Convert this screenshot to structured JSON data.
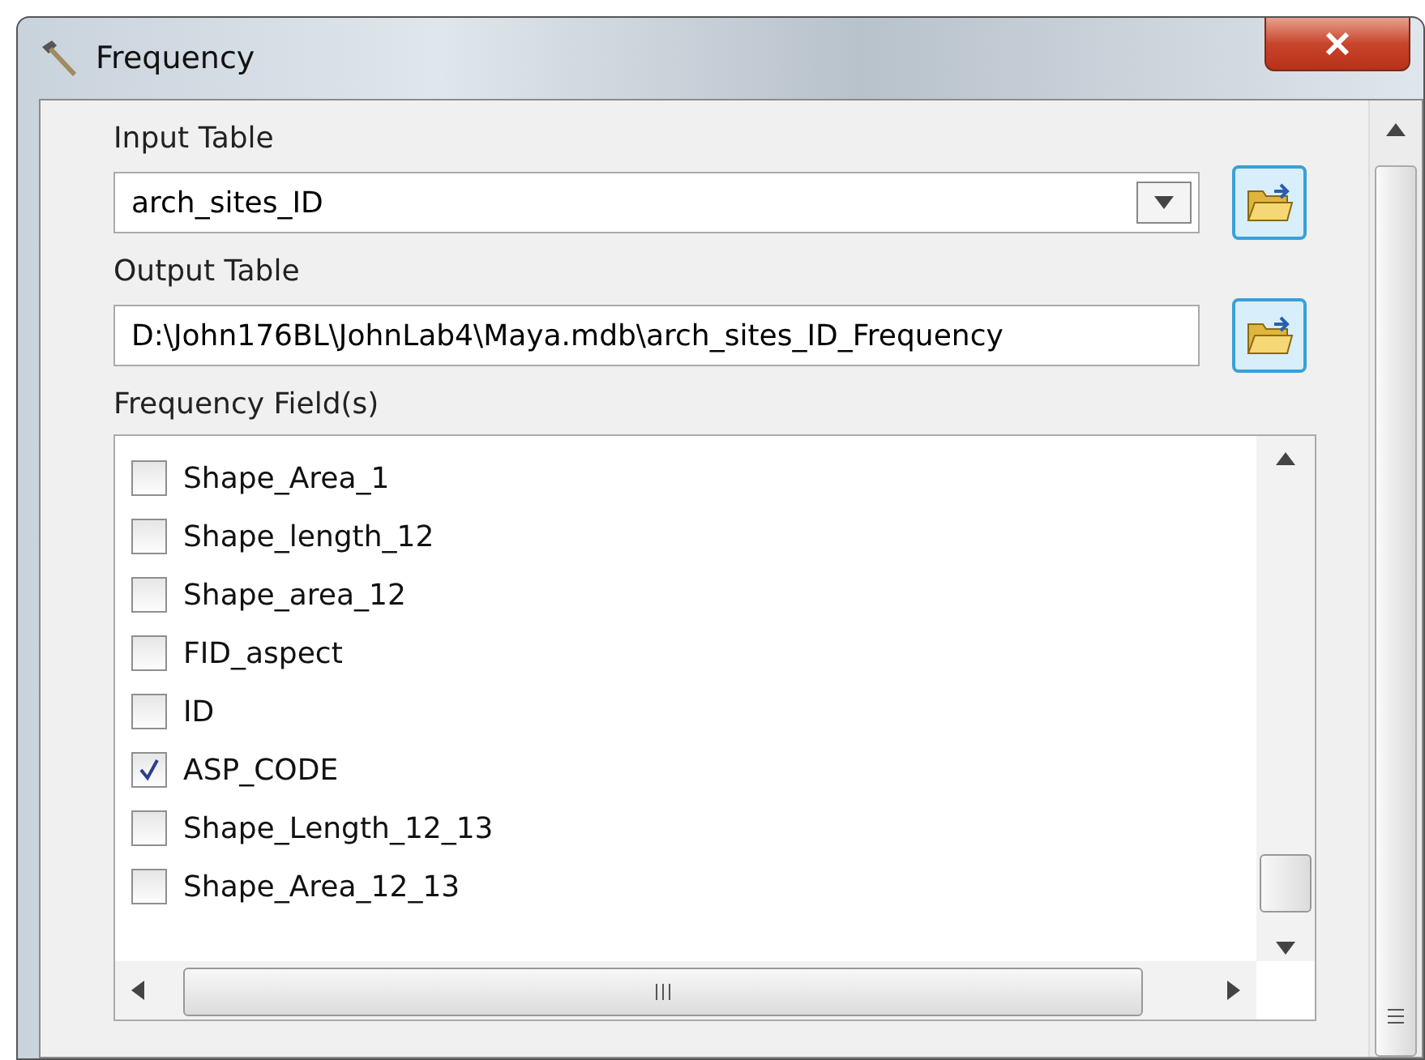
{
  "window": {
    "title": "Frequency"
  },
  "input_table": {
    "label": "Input Table",
    "value": "arch_sites_ID"
  },
  "output_table": {
    "label": "Output Table",
    "value": "D:\\John176BL\\JohnLab4\\Maya.mdb\\arch_sites_ID_Frequency"
  },
  "frequency_fields": {
    "label": "Frequency Field(s)",
    "items": [
      {
        "label": "Shape_Area_1",
        "checked": false
      },
      {
        "label": "Shape_length_12",
        "checked": false
      },
      {
        "label": "Shape_area_12",
        "checked": false
      },
      {
        "label": "FID_aspect",
        "checked": false
      },
      {
        "label": "ID",
        "checked": false
      },
      {
        "label": "ASP_CODE",
        "checked": true
      },
      {
        "label": "Shape_Length_12_13",
        "checked": false
      },
      {
        "label": "Shape_Area_12_13",
        "checked": false
      }
    ]
  }
}
